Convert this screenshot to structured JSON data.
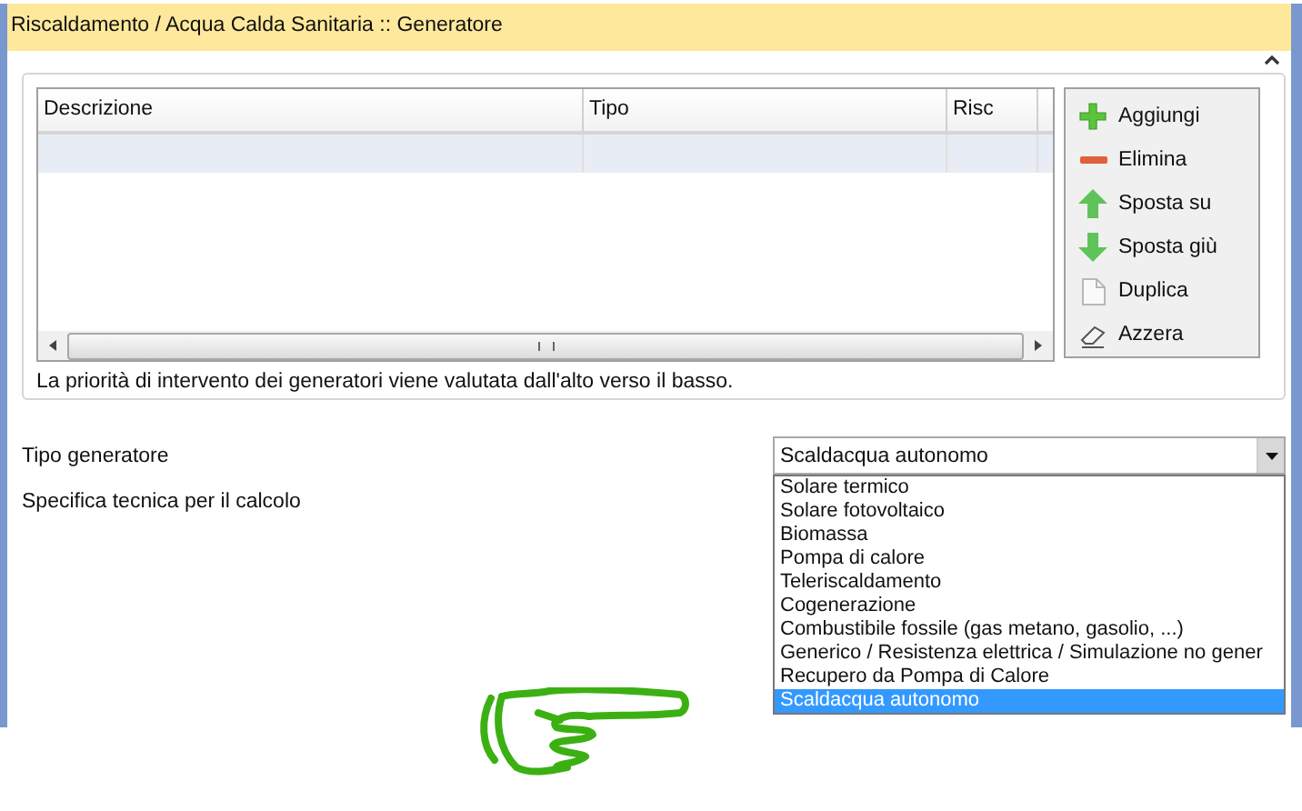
{
  "window": {
    "title": "Riscaldamento / Acqua Calda Sanitaria :: Generatore",
    "collapsed": false
  },
  "table": {
    "columns": [
      "Descrizione",
      "Tipo",
      "Risc"
    ],
    "rows": [
      {
        "selected": true
      }
    ]
  },
  "buttons": [
    {
      "label": "Aggiungi",
      "kind": "add"
    },
    {
      "label": "Elimina",
      "kind": "remove"
    },
    {
      "label": "Sposta su",
      "kind": "up"
    },
    {
      "label": "Sposta giù",
      "kind": "down"
    },
    {
      "label": "Duplica",
      "kind": "copy"
    },
    {
      "label": "Azzera",
      "kind": "erase"
    }
  ],
  "note": "La priorità di intervento dei generatori viene valutata dall'alto verso il basso.",
  "fields": [
    {
      "label": "Tipo generatore",
      "value": "Scaldacqua autonomo",
      "expanded": true,
      "options": [
        {
          "label": "Solare termico",
          "selected": false
        },
        {
          "label": "Solare fotovoltaico",
          "selected": false
        },
        {
          "label": "Biomassa",
          "selected": false
        },
        {
          "label": "Pompa di calore",
          "selected": false
        },
        {
          "label": "Teleriscaldamento",
          "selected": false
        },
        {
          "label": "Cogenerazione",
          "selected": false
        },
        {
          "label": "Combustibile fossile (gas metano, gasolio, ...)",
          "selected": false
        },
        {
          "label": "Generico / Resistenza elettrica / Simulazione no gener",
          "selected": false
        },
        {
          "label": "Recupero da Pompa di Calore",
          "selected": false
        },
        {
          "label": "Scaldacqua autonomo",
          "selected": true
        }
      ]
    },
    {
      "label": "Specifica tecnica per il calcolo"
    }
  ]
}
